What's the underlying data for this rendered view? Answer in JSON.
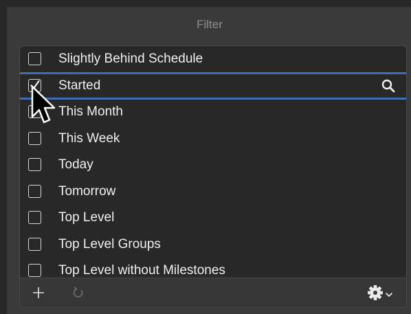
{
  "filter": {
    "title": "Filter",
    "items": [
      {
        "label": "Slightly Behind Schedule",
        "checked": false
      },
      {
        "label": "Started",
        "checked": true
      },
      {
        "label": "This Month",
        "checked": false
      },
      {
        "label": "This Week",
        "checked": false
      },
      {
        "label": "Today",
        "checked": false
      },
      {
        "label": "Tomorrow",
        "checked": false
      },
      {
        "label": "Top Level",
        "checked": false
      },
      {
        "label": "Top Level Groups",
        "checked": false
      },
      {
        "label": "Top Level without Milestones",
        "checked": false
      }
    ],
    "selected_index": 1
  },
  "footer": {
    "icons": [
      "plus-icon",
      "refresh-icon",
      "gear-menu-icon"
    ]
  },
  "colors": {
    "selection": "#3d6fb4",
    "list_background": "#282828",
    "panel_background": "#3a3a3a"
  }
}
